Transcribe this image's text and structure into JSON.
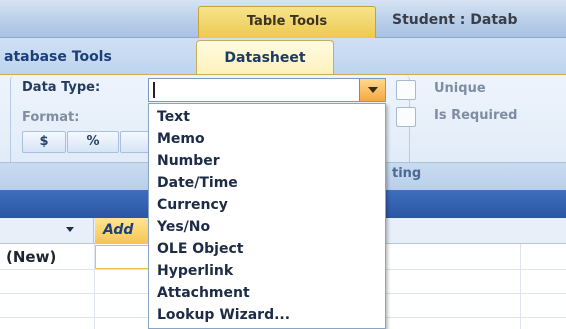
{
  "title_bar": {
    "contextual_tab": "Table Tools",
    "window_title": "Student : Datab"
  },
  "ribbon": {
    "tabs": [
      {
        "label": "atabase Tools"
      },
      {
        "label": "Datasheet"
      }
    ],
    "data_type": {
      "label": "Data Type:",
      "value": "",
      "options": [
        "Text",
        "Memo",
        "Number",
        "Date/Time",
        "Currency",
        "Yes/No",
        "OLE Object",
        "Hyperlink",
        "Attachment",
        "Lookup Wizard..."
      ]
    },
    "format_label": "Format:",
    "format_buttons": {
      "currency": "$",
      "percent": "%"
    },
    "checkboxes": {
      "unique": "Unique",
      "is_required": "Is Required"
    },
    "group_label": "ting"
  },
  "datasheet": {
    "add_column_header": "Add",
    "new_row_label": "(New)"
  },
  "colors": {
    "contextual_tab": "#edc94f",
    "active_tab": "#fdf1b9",
    "ribbon": "#dde9f7",
    "doc_header": "#2c56a4",
    "dropdown_arrow": "#f5a845"
  },
  "icons": {
    "dropdown": "chevron-down-icon",
    "sort": "sort-arrow-icon"
  }
}
